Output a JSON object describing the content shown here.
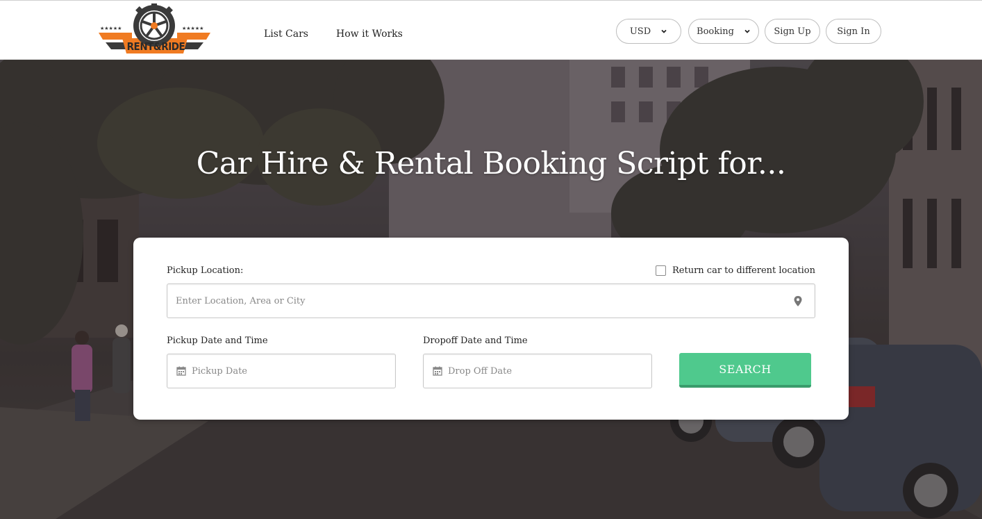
{
  "brand": {
    "name": "RENT&RIDE"
  },
  "nav": {
    "links": [
      "List Cars",
      "How it Works"
    ]
  },
  "header_controls": {
    "currency": "USD",
    "booking": "Booking",
    "signup": "Sign Up",
    "signin": "Sign In"
  },
  "hero": {
    "title": "Car Hire & Rental Booking Script for..."
  },
  "search": {
    "pickup_location_label": "Pickup Location:",
    "return_label": "Return car to different location",
    "return_checked": false,
    "location_placeholder": "Enter Location, Area or City",
    "pickup_dt_label": "Pickup Date and Time",
    "dropoff_dt_label": "Dropoff Date and Time",
    "pickup_placeholder": "Pickup Date",
    "dropoff_placeholder": "Drop Off Date",
    "button": "SEARCH"
  },
  "icons": {
    "logo": "wheel-logo-icon",
    "currency_dropdown": "chevron-down-icon",
    "booking_dropdown": "chevron-down-icon",
    "location": "map-pin-icon",
    "pickup_date": "calendar-icon",
    "dropoff_date": "calendar-icon"
  },
  "colors": {
    "accent": "#4fc98d",
    "accent_dark": "#3a9c6c",
    "logo_orange": "#f07b22",
    "logo_dark": "#3a3a3a"
  }
}
